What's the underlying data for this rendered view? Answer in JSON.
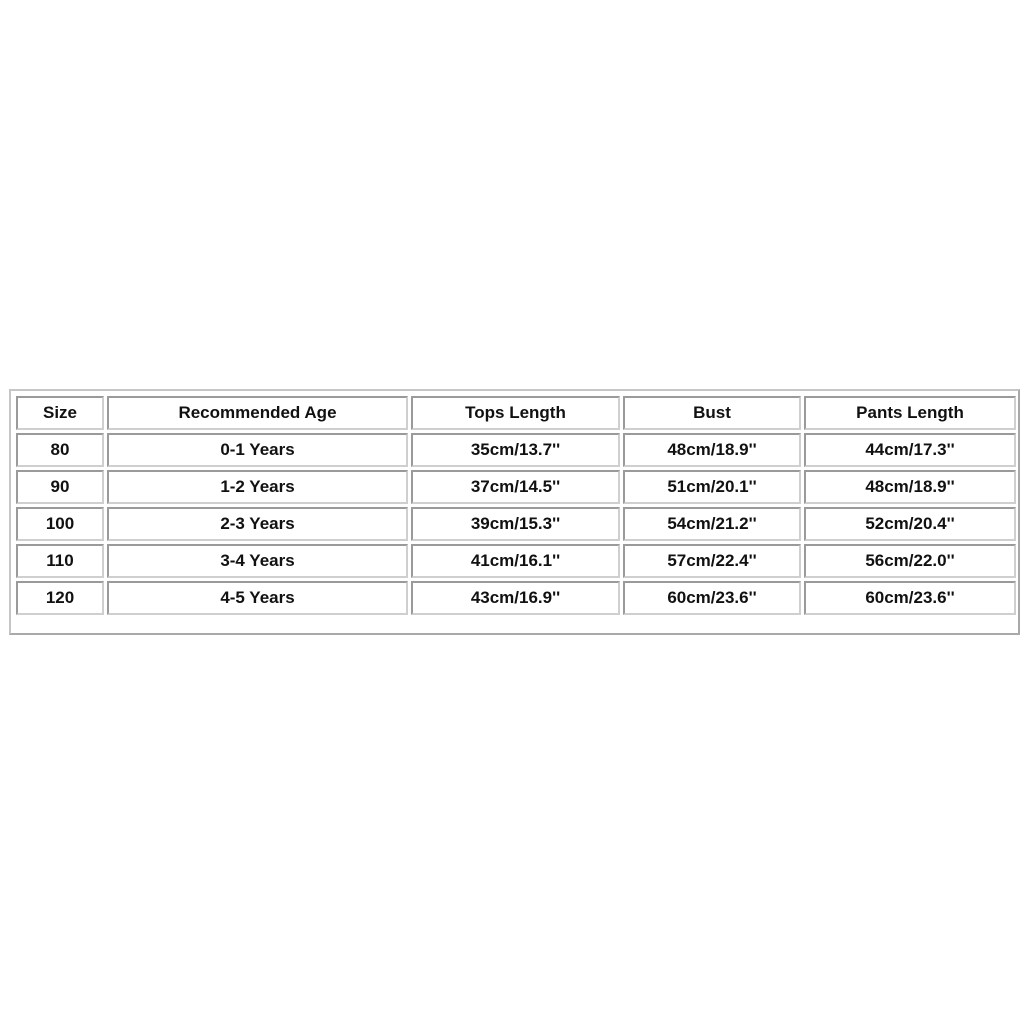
{
  "size_chart": {
    "headers": [
      "Size",
      "Recommended Age",
      "Tops Length",
      "Bust",
      "Pants Length"
    ],
    "rows": [
      [
        "80",
        "0-1 Years",
        "35cm/13.7''",
        "48cm/18.9''",
        "44cm/17.3''"
      ],
      [
        "90",
        "1-2 Years",
        "37cm/14.5''",
        "51cm/20.1''",
        "48cm/18.9''"
      ],
      [
        "100",
        "2-3 Years",
        "39cm/15.3''",
        "54cm/21.2''",
        "52cm/20.4''"
      ],
      [
        "110",
        "3-4 Years",
        "41cm/16.1''",
        "57cm/22.4''",
        "56cm/22.0''"
      ],
      [
        "120",
        "4-5 Years",
        "43cm/16.9''",
        "60cm/23.6''",
        "60cm/23.6''"
      ]
    ]
  },
  "colors": {
    "background": "#ffffff",
    "text": "#111111",
    "border": "#b3b3b3"
  }
}
